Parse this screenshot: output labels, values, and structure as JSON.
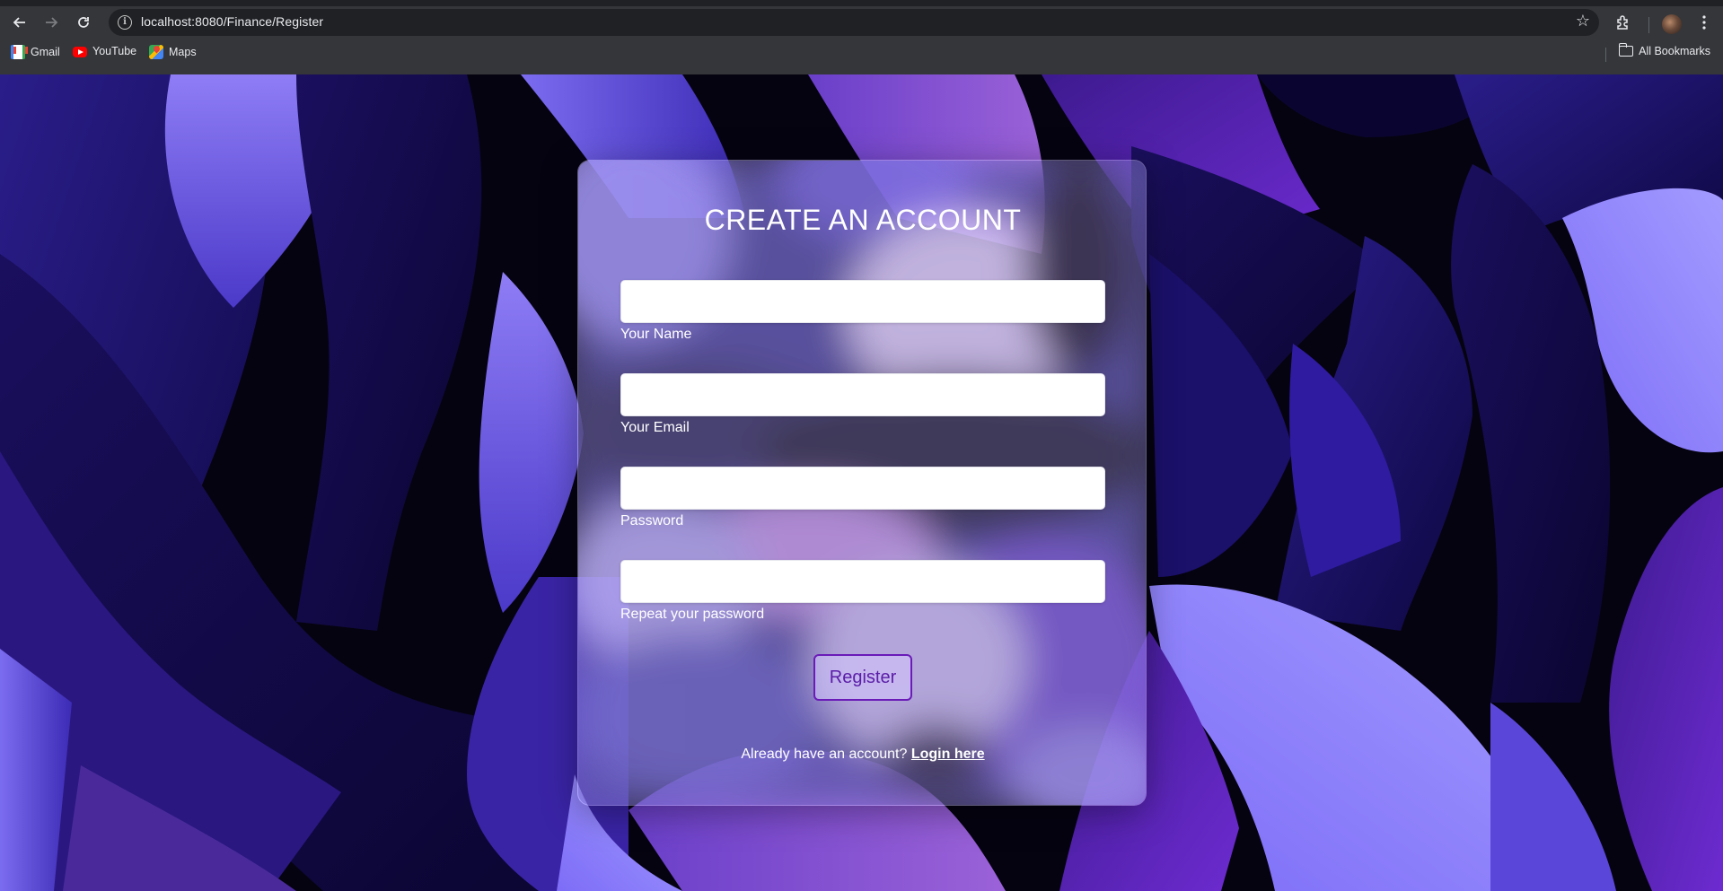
{
  "browser": {
    "url": "localhost:8080/Finance/Register",
    "bookmarks": [
      {
        "label": "Gmail",
        "icon": "gmail-icon"
      },
      {
        "label": "YouTube",
        "icon": "youtube-icon"
      },
      {
        "label": "Maps",
        "icon": "maps-icon"
      }
    ],
    "all_bookmarks_label": "All Bookmarks"
  },
  "form": {
    "title": "CREATE AN ACCOUNT",
    "fields": [
      {
        "label": "Your Name",
        "value": ""
      },
      {
        "label": "Your Email",
        "value": ""
      },
      {
        "label": "Password",
        "value": ""
      },
      {
        "label": "Repeat your password",
        "value": ""
      }
    ],
    "submit_label": "Register",
    "footer_text": "Already have an account?",
    "login_link": "Login here"
  },
  "colors": {
    "accent": "#6a1bb8",
    "card_tint": "#beafff"
  }
}
